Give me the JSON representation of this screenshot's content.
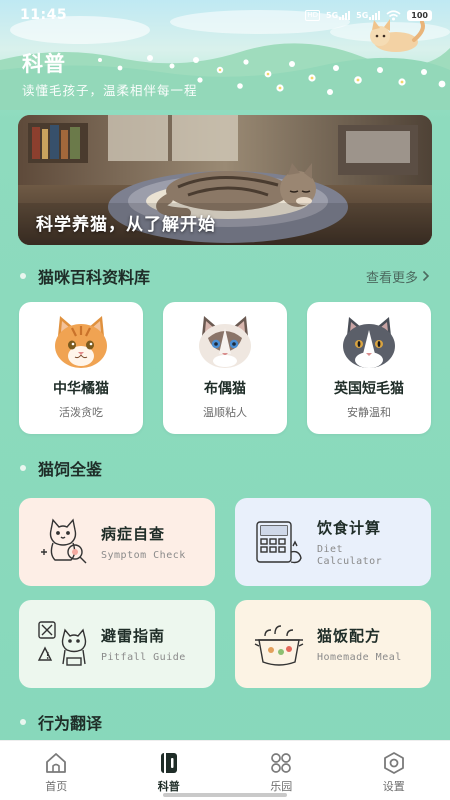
{
  "status_bar": {
    "time": "11:45",
    "hd_label": "HD",
    "net1": "5G",
    "net2": "5G",
    "battery": "100"
  },
  "header": {
    "title": "科普",
    "subtitle": "读懂毛孩子，温柔相伴每一程"
  },
  "banner": {
    "caption": "科学养猫，从了解开始"
  },
  "encyclopedia": {
    "title": "猫咪百科资料库",
    "more_label": "查看更多",
    "cats": [
      {
        "name": "中华橘猫",
        "desc": "活泼贪吃",
        "icon": "orange-cat-icon"
      },
      {
        "name": "布偶猫",
        "desc": "温顺粘人",
        "icon": "ragdoll-cat-icon"
      },
      {
        "name": "英国短毛猫",
        "desc": "安静温和",
        "icon": "british-shorthair-icon"
      }
    ]
  },
  "guide": {
    "title": "猫饲全鉴",
    "features": [
      {
        "title": "病症自查",
        "subtitle": "Symptom Check",
        "icon": "symptom-check-icon",
        "color": "#fdeee6"
      },
      {
        "title": "饮食计算",
        "subtitle": "Diet\nCalculator",
        "icon": "diet-calculator-icon",
        "color": "#e9f0fb"
      },
      {
        "title": "避雷指南",
        "subtitle": "Pitfall Guide",
        "icon": "pitfall-guide-icon",
        "color": "#edf7ee"
      },
      {
        "title": "猫饭配方",
        "subtitle": "Homemade Meal",
        "icon": "homemade-meal-icon",
        "color": "#fcf3e4"
      }
    ]
  },
  "behavior": {
    "title": "行为翻译"
  },
  "bottom_nav": {
    "items": [
      {
        "label": "首页",
        "icon": "home-icon",
        "active": false
      },
      {
        "label": "科普",
        "icon": "book-icon",
        "active": true
      },
      {
        "label": "乐园",
        "icon": "grid-icon",
        "active": false
      },
      {
        "label": "设置",
        "icon": "settings-icon",
        "active": false
      }
    ]
  },
  "colors": {
    "background": "#8edbbe",
    "card": "#ffffff",
    "text_primary": "#1f2d28"
  }
}
